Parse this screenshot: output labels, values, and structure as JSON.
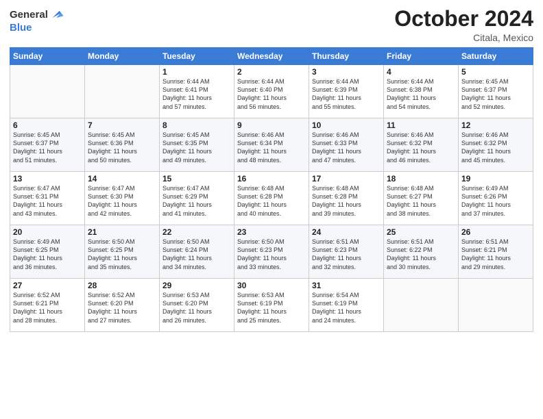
{
  "header": {
    "logo": {
      "general": "General",
      "blue": "Blue"
    },
    "month_title": "October 2024",
    "location": "Citala, Mexico"
  },
  "weekdays": [
    "Sunday",
    "Monday",
    "Tuesday",
    "Wednesday",
    "Thursday",
    "Friday",
    "Saturday"
  ],
  "weeks": [
    [
      {
        "day": "",
        "info": ""
      },
      {
        "day": "",
        "info": ""
      },
      {
        "day": "1",
        "info": "Sunrise: 6:44 AM\nSunset: 6:41 PM\nDaylight: 11 hours\nand 57 minutes."
      },
      {
        "day": "2",
        "info": "Sunrise: 6:44 AM\nSunset: 6:40 PM\nDaylight: 11 hours\nand 56 minutes."
      },
      {
        "day": "3",
        "info": "Sunrise: 6:44 AM\nSunset: 6:39 PM\nDaylight: 11 hours\nand 55 minutes."
      },
      {
        "day": "4",
        "info": "Sunrise: 6:44 AM\nSunset: 6:38 PM\nDaylight: 11 hours\nand 54 minutes."
      },
      {
        "day": "5",
        "info": "Sunrise: 6:45 AM\nSunset: 6:37 PM\nDaylight: 11 hours\nand 52 minutes."
      }
    ],
    [
      {
        "day": "6",
        "info": "Sunrise: 6:45 AM\nSunset: 6:37 PM\nDaylight: 11 hours\nand 51 minutes."
      },
      {
        "day": "7",
        "info": "Sunrise: 6:45 AM\nSunset: 6:36 PM\nDaylight: 11 hours\nand 50 minutes."
      },
      {
        "day": "8",
        "info": "Sunrise: 6:45 AM\nSunset: 6:35 PM\nDaylight: 11 hours\nand 49 minutes."
      },
      {
        "day": "9",
        "info": "Sunrise: 6:46 AM\nSunset: 6:34 PM\nDaylight: 11 hours\nand 48 minutes."
      },
      {
        "day": "10",
        "info": "Sunrise: 6:46 AM\nSunset: 6:33 PM\nDaylight: 11 hours\nand 47 minutes."
      },
      {
        "day": "11",
        "info": "Sunrise: 6:46 AM\nSunset: 6:32 PM\nDaylight: 11 hours\nand 46 minutes."
      },
      {
        "day": "12",
        "info": "Sunrise: 6:46 AM\nSunset: 6:32 PM\nDaylight: 11 hours\nand 45 minutes."
      }
    ],
    [
      {
        "day": "13",
        "info": "Sunrise: 6:47 AM\nSunset: 6:31 PM\nDaylight: 11 hours\nand 43 minutes."
      },
      {
        "day": "14",
        "info": "Sunrise: 6:47 AM\nSunset: 6:30 PM\nDaylight: 11 hours\nand 42 minutes."
      },
      {
        "day": "15",
        "info": "Sunrise: 6:47 AM\nSunset: 6:29 PM\nDaylight: 11 hours\nand 41 minutes."
      },
      {
        "day": "16",
        "info": "Sunrise: 6:48 AM\nSunset: 6:28 PM\nDaylight: 11 hours\nand 40 minutes."
      },
      {
        "day": "17",
        "info": "Sunrise: 6:48 AM\nSunset: 6:28 PM\nDaylight: 11 hours\nand 39 minutes."
      },
      {
        "day": "18",
        "info": "Sunrise: 6:48 AM\nSunset: 6:27 PM\nDaylight: 11 hours\nand 38 minutes."
      },
      {
        "day": "19",
        "info": "Sunrise: 6:49 AM\nSunset: 6:26 PM\nDaylight: 11 hours\nand 37 minutes."
      }
    ],
    [
      {
        "day": "20",
        "info": "Sunrise: 6:49 AM\nSunset: 6:25 PM\nDaylight: 11 hours\nand 36 minutes."
      },
      {
        "day": "21",
        "info": "Sunrise: 6:50 AM\nSunset: 6:25 PM\nDaylight: 11 hours\nand 35 minutes."
      },
      {
        "day": "22",
        "info": "Sunrise: 6:50 AM\nSunset: 6:24 PM\nDaylight: 11 hours\nand 34 minutes."
      },
      {
        "day": "23",
        "info": "Sunrise: 6:50 AM\nSunset: 6:23 PM\nDaylight: 11 hours\nand 33 minutes."
      },
      {
        "day": "24",
        "info": "Sunrise: 6:51 AM\nSunset: 6:23 PM\nDaylight: 11 hours\nand 32 minutes."
      },
      {
        "day": "25",
        "info": "Sunrise: 6:51 AM\nSunset: 6:22 PM\nDaylight: 11 hours\nand 30 minutes."
      },
      {
        "day": "26",
        "info": "Sunrise: 6:51 AM\nSunset: 6:21 PM\nDaylight: 11 hours\nand 29 minutes."
      }
    ],
    [
      {
        "day": "27",
        "info": "Sunrise: 6:52 AM\nSunset: 6:21 PM\nDaylight: 11 hours\nand 28 minutes."
      },
      {
        "day": "28",
        "info": "Sunrise: 6:52 AM\nSunset: 6:20 PM\nDaylight: 11 hours\nand 27 minutes."
      },
      {
        "day": "29",
        "info": "Sunrise: 6:53 AM\nSunset: 6:20 PM\nDaylight: 11 hours\nand 26 minutes."
      },
      {
        "day": "30",
        "info": "Sunrise: 6:53 AM\nSunset: 6:19 PM\nDaylight: 11 hours\nand 25 minutes."
      },
      {
        "day": "31",
        "info": "Sunrise: 6:54 AM\nSunset: 6:19 PM\nDaylight: 11 hours\nand 24 minutes."
      },
      {
        "day": "",
        "info": ""
      },
      {
        "day": "",
        "info": ""
      }
    ]
  ]
}
